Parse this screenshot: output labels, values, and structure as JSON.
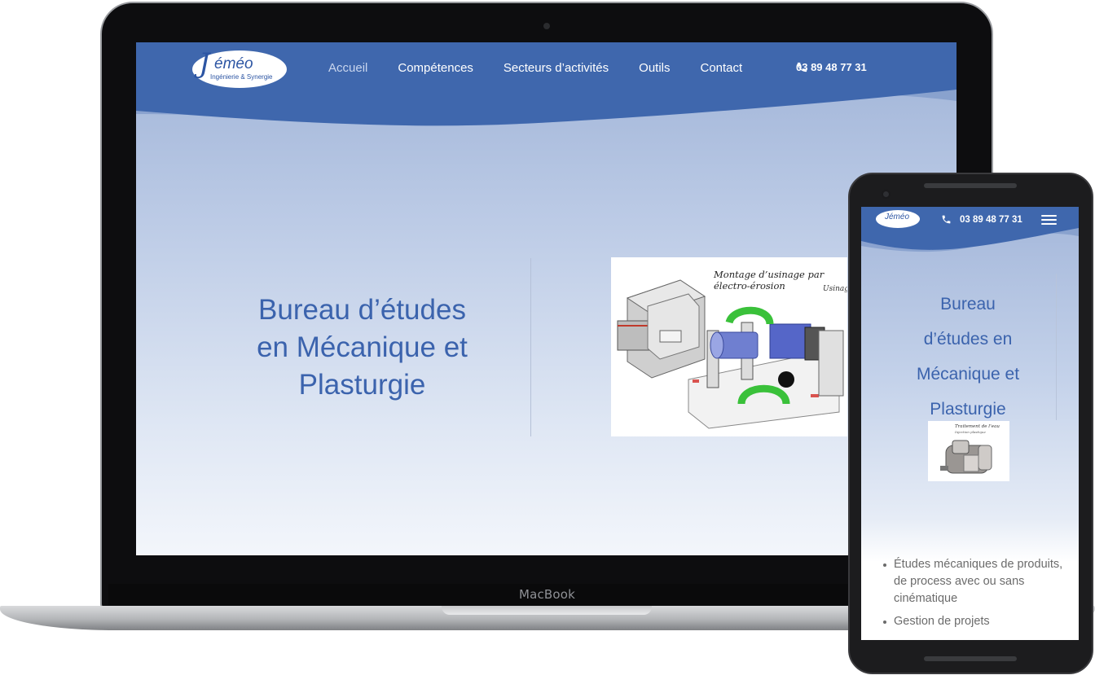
{
  "desktop": {
    "logo": {
      "initial": "J",
      "name": "éméo",
      "tagline": "Ingénierie & Synergie"
    },
    "nav": [
      {
        "label": "Accueil",
        "active": true
      },
      {
        "label": "Compétences",
        "active": false
      },
      {
        "label": "Secteurs d’activités",
        "active": false
      },
      {
        "label": "Outils",
        "active": false
      },
      {
        "label": "Contact",
        "active": false
      }
    ],
    "phone": "03 89 48 77 31",
    "hero_title_lines": [
      "Bureau d’études",
      "en Mécanique et",
      "Plasturgie"
    ],
    "image_caption": "Montage d’usinage par électro-érosion",
    "image_subcaption": "Usinage"
  },
  "laptop_brand": "MacBook",
  "mobile": {
    "logo": "Jéméo",
    "phone": "03 89 48 77 31",
    "title_lines": [
      "Bureau",
      "d’études en",
      "Mécanique et",
      "Plasturgie"
    ],
    "image_caption": "Traitement de l’eau",
    "image_subcaption": "Injection plastique",
    "list": [
      "Études mécaniques de produits, de process avec ou sans cinématique",
      "Gestion de projets"
    ]
  },
  "colors": {
    "brand_blue": "#3b63ad",
    "header_blue": "#3f67ad",
    "wave_light": "#7f99c9"
  },
  "icons": [
    "phone-icon",
    "menu-icon",
    "camera-icon"
  ]
}
